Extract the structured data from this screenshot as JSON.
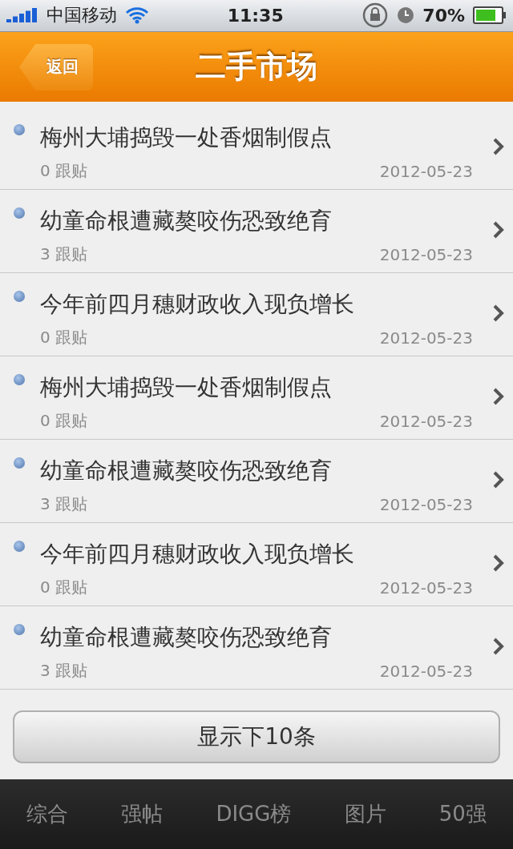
{
  "status_bar": {
    "carrier": "中国移动",
    "time": "11:35",
    "battery": "70%"
  },
  "nav_bar": {
    "back": "返回",
    "title": "二手市场"
  },
  "posts": [
    {
      "title": "梅州大埔捣毁一处香烟制假点",
      "replies": "0 跟贴",
      "date": "2012-05-23"
    },
    {
      "title": "幼童命根遭藏獒咬伤恐致绝育",
      "replies": "3 跟贴",
      "date": "2012-05-23"
    },
    {
      "title": "今年前四月穗财政收入现负增长",
      "replies": "0 跟贴",
      "date": "2012-05-23"
    },
    {
      "title": "梅州大埔捣毁一处香烟制假点",
      "replies": "0 跟贴",
      "date": "2012-05-23"
    },
    {
      "title": "幼童命根遭藏獒咬伤恐致绝育",
      "replies": "3 跟贴",
      "date": "2012-05-23"
    },
    {
      "title": "今年前四月穗财政收入现负增长",
      "replies": "0 跟贴",
      "date": "2012-05-23"
    },
    {
      "title": "幼童命根遭藏獒咬伤恐致绝育",
      "replies": "3 跟贴",
      "date": "2012-05-23"
    }
  ],
  "more_button": "显示下10条",
  "tabs": [
    {
      "label": "综合",
      "selected": false
    },
    {
      "label": "强帖",
      "selected": false
    },
    {
      "label": "DIGG榜",
      "selected": false
    },
    {
      "label": "图片",
      "selected": false
    },
    {
      "label": "50强",
      "selected": false
    }
  ]
}
